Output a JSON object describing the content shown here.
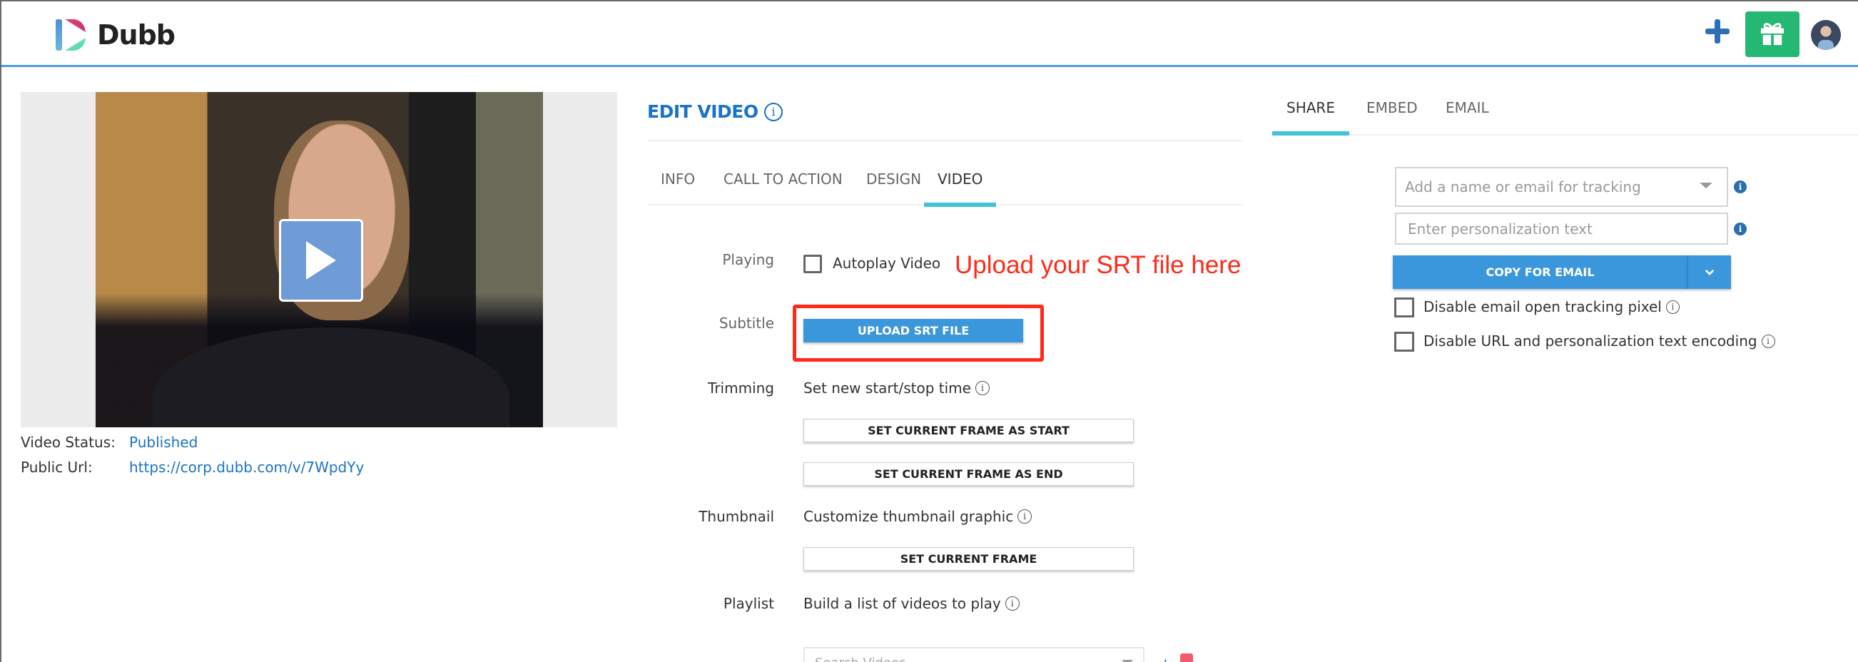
{
  "app": {
    "name": "Dubb",
    "brand_color": "#4a9fdc",
    "accent_color": "#41c3d3",
    "primary_button_color": "#3b97db",
    "gift_color": "#25b872"
  },
  "header": {
    "logo_text": "Dubb",
    "icons": [
      "plus-icon",
      "gift-icon",
      "avatar"
    ]
  },
  "video": {
    "status_label": "Video Status:",
    "status_value": "Published",
    "url_label": "Public Url:",
    "url_value": "https://corp.dubb.com/v/7WpdYy",
    "play_icon": "play-icon"
  },
  "edit": {
    "title": "EDIT VIDEO",
    "info_glyph": "i",
    "tabs": [
      {
        "label": "INFO",
        "active": false
      },
      {
        "label": "CALL TO ACTION",
        "active": false
      },
      {
        "label": "DESIGN",
        "active": false
      },
      {
        "label": "VIDEO",
        "active": true
      }
    ],
    "playing": {
      "label": "Playing",
      "checkbox_label": "Autoplay Video",
      "checked": false
    },
    "annotation": "Upload your SRT file here",
    "subtitle": {
      "label": "Subtitle",
      "button": "UPLOAD SRT FILE"
    },
    "trimming": {
      "label": "Trimming",
      "description": "Set new start/stop time",
      "start_button": "SET CURRENT FRAME AS START",
      "end_button": "SET CURRENT FRAME AS END"
    },
    "thumbnail": {
      "label": "Thumbnail",
      "description": "Customize thumbnail graphic",
      "button": "SET CURRENT FRAME"
    },
    "playlist": {
      "label": "Playlist",
      "description": "Build a list of videos to play",
      "search_placeholder": "Search Videos"
    }
  },
  "share": {
    "tabs": [
      {
        "label": "SHARE",
        "active": true
      },
      {
        "label": "EMBED",
        "active": false
      },
      {
        "label": "EMAIL",
        "active": false
      }
    ],
    "tracking_placeholder": "Add a name or email for tracking",
    "personalization_placeholder": "Enter personalization text",
    "copy_button": "COPY FOR EMAIL",
    "options": [
      {
        "label": "Disable email open tracking pixel",
        "checked": false
      },
      {
        "label": "Disable URL and personalization text encoding",
        "checked": false
      }
    ]
  }
}
